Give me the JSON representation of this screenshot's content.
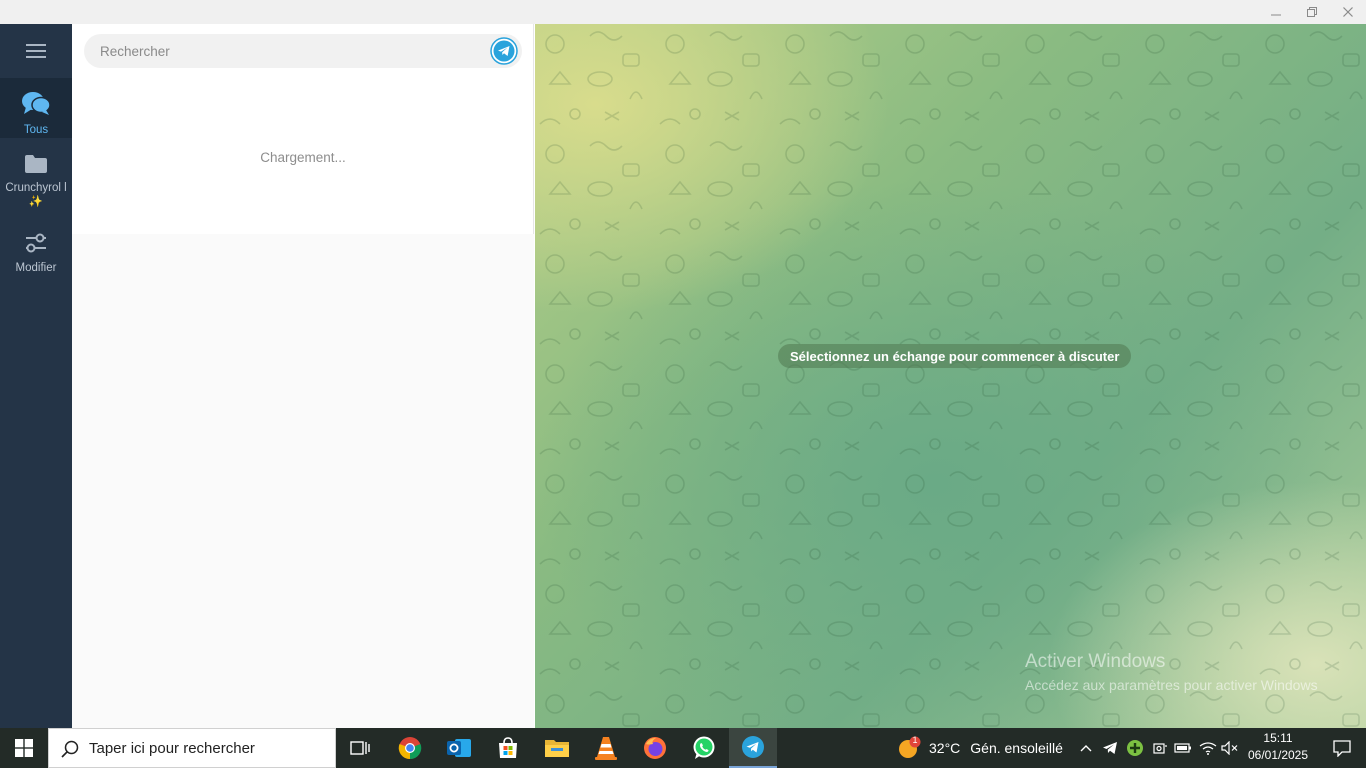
{
  "window": {
    "minimize_icon": "minimize-icon",
    "maximize_icon": "restore-icon",
    "close_icon": "close-icon"
  },
  "sidebar": {
    "menu_icon": "hamburger-icon",
    "folders": [
      {
        "label": "Tous",
        "icon": "chat-bubbles-icon",
        "active": true
      },
      {
        "label": "Crunchyrol l✨",
        "icon": "folder-icon",
        "active": false
      },
      {
        "label": "Modifier",
        "icon": "sliders-icon",
        "active": false
      }
    ]
  },
  "search": {
    "placeholder": "Rechercher",
    "value": ""
  },
  "chatlist": {
    "loading_text": "Chargement..."
  },
  "chat": {
    "empty_prompt": "Sélectionnez un échange pour commencer à discuter",
    "watermark_title": "Activer Windows",
    "watermark_sub": "Accédez aux paramètres pour activer Windows"
  },
  "taskbar": {
    "search_placeholder": "Taper ici pour rechercher",
    "apps": [
      "task-view",
      "chrome",
      "outlook",
      "microsoft-store",
      "file-explorer",
      "vlc",
      "firefox",
      "whatsapp",
      "telegram"
    ],
    "weather": {
      "badge": "1",
      "temperature": "32°C",
      "condition": "Gén. ensoleillé"
    },
    "clock": {
      "time": "15:11",
      "date": "06/01/2025"
    }
  },
  "colors": {
    "rail_bg": "#243447",
    "accent": "#5fb7f1",
    "telegram_blue": "#2aa3dc"
  }
}
